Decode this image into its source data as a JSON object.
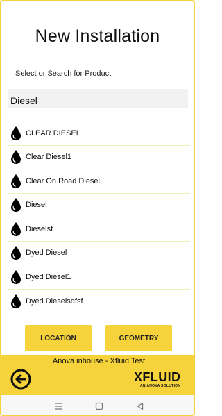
{
  "header": {
    "title": "New Installation",
    "subtitle": "Select or Search for Product"
  },
  "search": {
    "value": "Diesel"
  },
  "products": [
    {
      "label": "CLEAR DIESEL",
      "icon": "drop-icon"
    },
    {
      "label": "Clear Diesel1",
      "icon": "drop-icon"
    },
    {
      "label": "Clear On Road Diesel",
      "icon": "drop-icon"
    },
    {
      "label": "Diesel",
      "icon": "drop-icon"
    },
    {
      "label": "Dieselsf",
      "icon": "drop-icon"
    },
    {
      "label": "Dyed Diesel",
      "icon": "drop-icon"
    },
    {
      "label": "Dyed Diesel1",
      "icon": "drop-icon"
    },
    {
      "label": "Dyed Dieselsdfsf",
      "icon": "drop-icon"
    }
  ],
  "actions": {
    "location_label": "LOCATION",
    "geometry_label": "GEOMETRY"
  },
  "footer": {
    "text": "Anova inhouse - Xfluid Test",
    "back_icon": "back-arrow-icon",
    "logo_word": "XFLUID",
    "logo_tagline": "AN ANOVA SOLUTION"
  },
  "navbar": {
    "menu_icon": "menu-icon",
    "home_icon": "home-square-icon",
    "back_icon": "back-triangle-icon"
  },
  "colors": {
    "accent": "#f6d33a",
    "text": "#111111",
    "divider": "#ecefb8"
  }
}
